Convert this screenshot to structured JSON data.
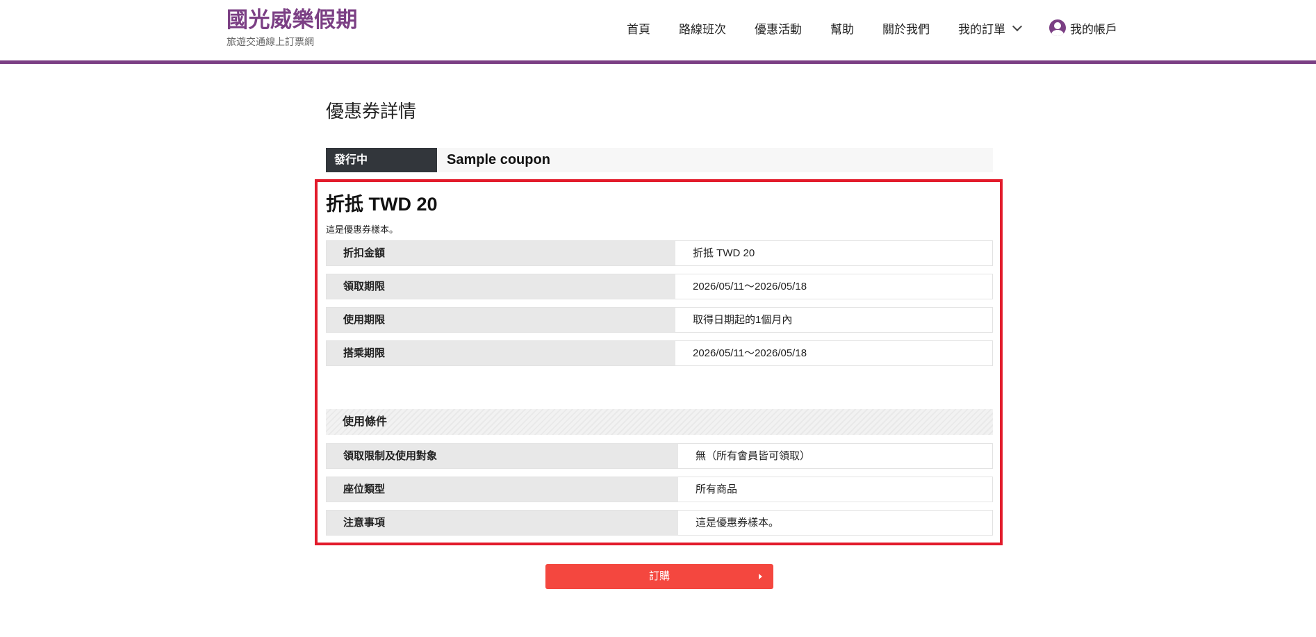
{
  "header": {
    "brand_title": "國光威樂假期",
    "brand_subtitle": "旅遊交通線上訂票網",
    "nav": {
      "home": "首頁",
      "routes": "路線班次",
      "promotions": "優惠活動",
      "help": "幫助",
      "about": "關於我們",
      "my_orders": "我的訂單",
      "my_account": "我的帳戶"
    },
    "accent_color": "#7b3f84"
  },
  "main": {
    "page_title": "優惠券詳情",
    "status": "發行中",
    "coupon_name": "Sample coupon",
    "discount_title": "折抵 TWD 20",
    "discount_description": "這是優惠券樣本。",
    "details": [
      {
        "label": "折扣金額",
        "value": "折抵 TWD 20"
      },
      {
        "label": "領取期限",
        "value": "2026/05/11～2026/05/18"
      },
      {
        "label": "使用期限",
        "value": "取得日期起的1個月內"
      },
      {
        "label": "搭乘期限",
        "value": "2026/05/11～2026/05/18"
      }
    ],
    "conditions_title": "使用條件",
    "conditions": [
      {
        "label": "領取限制及使用對象",
        "value": "無（所有會員皆可領取）"
      },
      {
        "label": "座位類型",
        "value": "所有商品"
      },
      {
        "label": "注意事項",
        "value": "這是優惠券樣本。"
      }
    ],
    "order_button": "訂購",
    "highlight_color": "#e21b2b",
    "button_color": "#f4473f"
  }
}
